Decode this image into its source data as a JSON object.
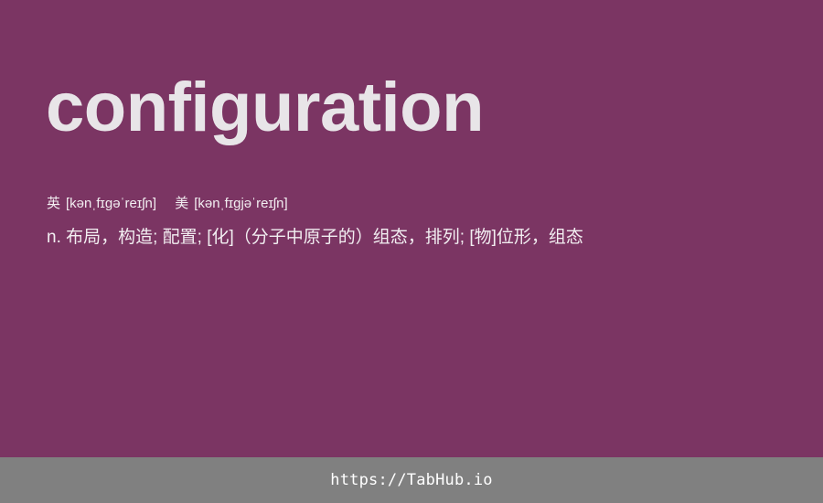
{
  "card": {
    "word": "configuration",
    "phonetics": {
      "uk": {
        "tag": "英",
        "ipa": "[kənˌfɪɡəˈreɪʃn]"
      },
      "us": {
        "tag": "美",
        "ipa": "[kənˌfɪɡjəˈreɪʃn]"
      }
    },
    "definition": "n. 布局，构造; 配置; [化]（分子中原子的）组态，排列; [物]位形，组态"
  },
  "footer": {
    "link": "https://TabHub.io"
  },
  "colors": {
    "background": "#7b3563",
    "word_text": "#e8e5e8",
    "footer_background": "#808080",
    "footer_text": "#ffffff"
  }
}
